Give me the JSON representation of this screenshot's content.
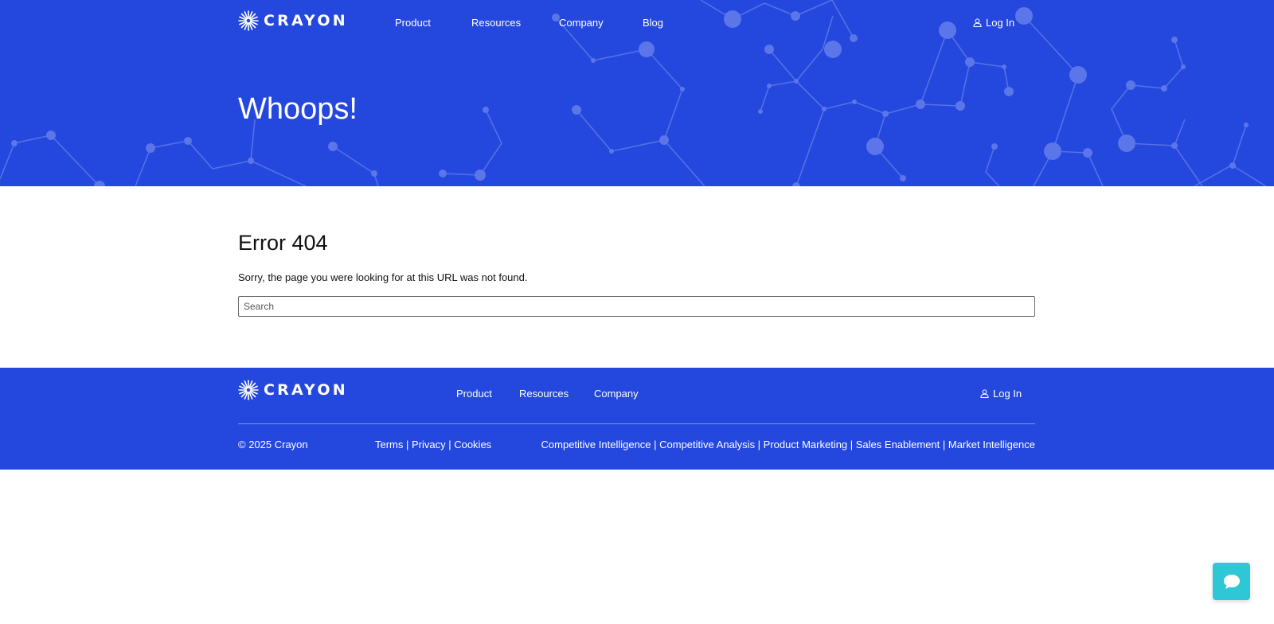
{
  "brand": {
    "name": "CRAYON"
  },
  "header": {
    "nav": [
      {
        "label": "Product"
      },
      {
        "label": "Resources"
      },
      {
        "label": "Company"
      },
      {
        "label": "Blog"
      }
    ],
    "login_label": "Log In"
  },
  "hero": {
    "title": "Whoops!"
  },
  "main": {
    "error_title": "Error 404",
    "error_message": "Sorry, the page you were looking for at this URL was not found.",
    "search_placeholder": "Search"
  },
  "footer": {
    "nav": [
      {
        "label": "Product"
      },
      {
        "label": "Resources"
      },
      {
        "label": "Company"
      }
    ],
    "login_label": "Log In",
    "copyright": "© 2025 Crayon",
    "legal_links": "Terms | Privacy | Cookies",
    "topic_links": "Competitive Intelligence | Competitive Analysis | Product Marketing | Sales Enablement | Market Intelligence"
  },
  "colors": {
    "brand_blue": "#2447de",
    "network_line": "#5a76e8",
    "chat_teal": "#2ec7d6"
  },
  "icons": {
    "logo": "sunburst-icon",
    "login": "user-icon",
    "chat": "chat-bubble-icon"
  }
}
